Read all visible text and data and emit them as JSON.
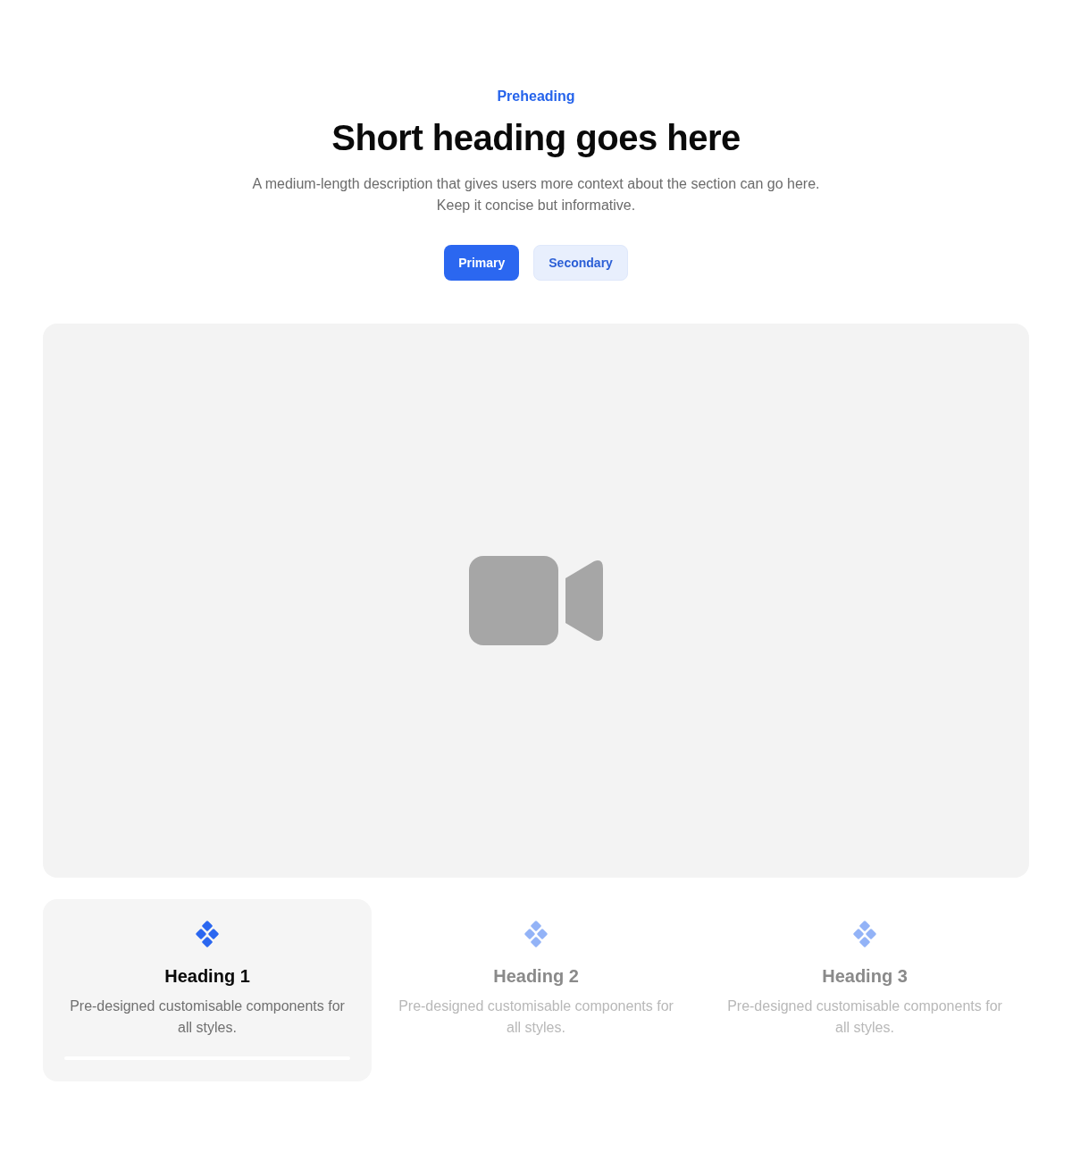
{
  "header": {
    "preheading": "Preheading",
    "heading": "Short heading goes here",
    "description": "A medium-length description that gives users more context about the section can go here. Keep it concise but informative."
  },
  "buttons": [
    {
      "kind": "primary",
      "label": "Primary"
    },
    {
      "kind": "secondary",
      "label": "Secondary"
    }
  ],
  "media": {
    "kind": "video"
  },
  "tabs": [
    {
      "heading": "Heading 1",
      "description": "Pre-designed customisable components for all styles.",
      "selected": true
    },
    {
      "heading": "Heading 2",
      "description": "Pre-designed customisable components for all styles.",
      "selected": false
    },
    {
      "heading": "Heading 3",
      "description": "Pre-designed customisable components for all styles.",
      "selected": false
    }
  ]
}
